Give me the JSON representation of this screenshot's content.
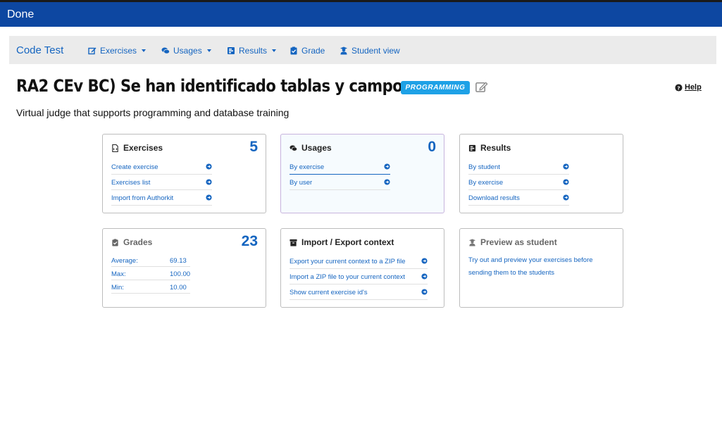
{
  "topbar": {
    "done_label": "Done"
  },
  "navbar": {
    "brand": "Code Test",
    "items": [
      {
        "label": "Exercises",
        "icon": "edit-icon",
        "dropdown": true
      },
      {
        "label": "Usages",
        "icon": "comments-icon",
        "dropdown": true
      },
      {
        "label": "Results",
        "icon": "poll-icon",
        "dropdown": true
      },
      {
        "label": "Grade",
        "icon": "clipboard-check-icon",
        "dropdown": false
      },
      {
        "label": "Student view",
        "icon": "user-graduate-icon",
        "dropdown": false
      }
    ]
  },
  "header": {
    "title": "RA2 CEv BC) Se han identificado tablas y campos.",
    "badge": "PROGRAMMING",
    "help": "Help",
    "subtitle": "Virtual judge that supports programming and database training"
  },
  "cards": {
    "exercises": {
      "title": "Exercises",
      "count": "5",
      "links": [
        "Create exercise",
        "Exercises list",
        "Import from Authorkit"
      ]
    },
    "usages": {
      "title": "Usages",
      "count": "0",
      "links": [
        "By exercise",
        "By user"
      ]
    },
    "results": {
      "title": "Results",
      "links": [
        "By student",
        "By exercise",
        "Download results"
      ]
    },
    "grades": {
      "title": "Grades",
      "count": "23",
      "stats": [
        {
          "label": "Average:",
          "value": "69.13"
        },
        {
          "label": "Max:",
          "value": "100.00"
        },
        {
          "label": "Min:",
          "value": "10.00"
        }
      ]
    },
    "import_export": {
      "title": "Import / Export context",
      "links": [
        "Export your current context to a ZIP file",
        "Import a ZIP file to your current context",
        "Show current exercise id's"
      ]
    },
    "preview": {
      "title": "Preview as student",
      "description": "Try out and preview your exercises before sending them to the students"
    }
  },
  "colors": {
    "topbar": "#0d47a1",
    "accent": "#1565c0",
    "badge": "#1ea1e6"
  }
}
